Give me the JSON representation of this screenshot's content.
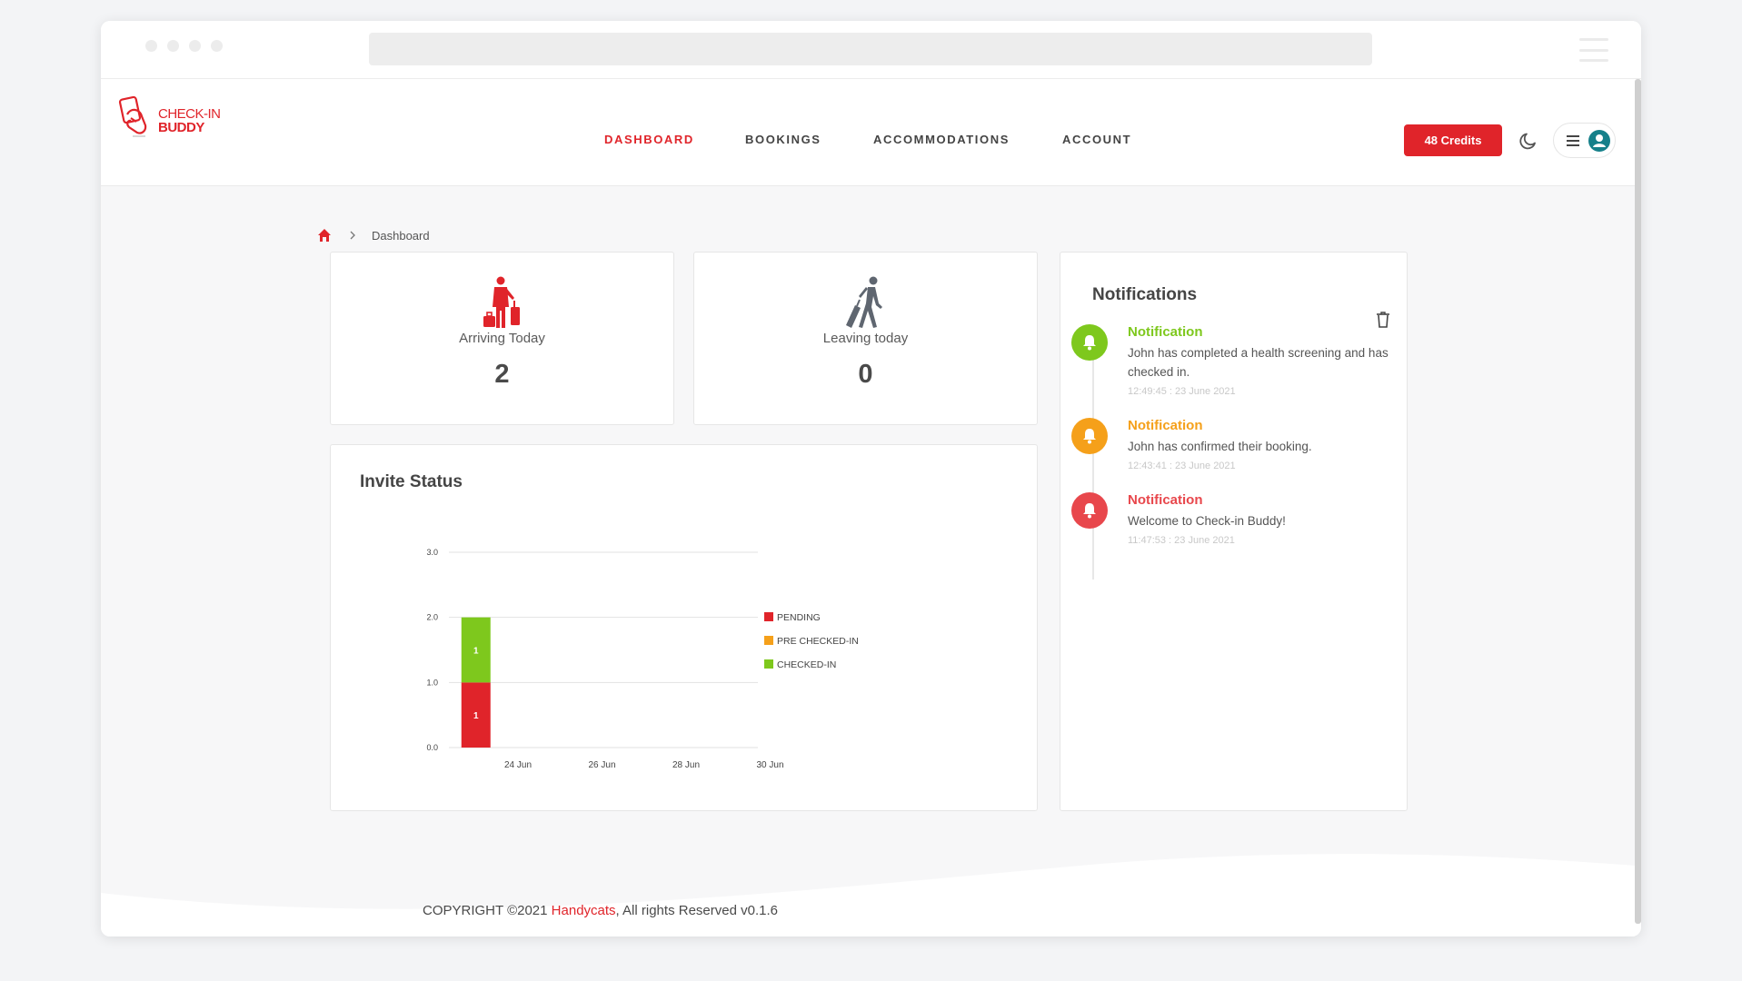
{
  "nav": {
    "links": [
      {
        "label": "DASHBOARD",
        "active": true
      },
      {
        "label": "BOOKINGS",
        "active": false
      },
      {
        "label": "ACCOMMODATIONS",
        "active": false
      },
      {
        "label": "ACCOUNT",
        "active": false
      }
    ],
    "credits_label": "48 Credits",
    "brand_line1": "CHECK-IN",
    "brand_line2": "BUDDY"
  },
  "breadcrumb": {
    "current": "Dashboard"
  },
  "stats": {
    "arriving": {
      "label": "Arriving Today",
      "value": "2"
    },
    "leaving": {
      "label": "Leaving today",
      "value": "0"
    }
  },
  "invite_status": {
    "title": "Invite Status"
  },
  "chart_data": {
    "type": "bar",
    "stacked": true,
    "title": "Invite Status",
    "x_ticks": [
      "24 Jun",
      "26 Jun",
      "28 Jun",
      "30 Jun"
    ],
    "y_ticks": [
      "0.0",
      "1.0",
      "2.0",
      "3.0"
    ],
    "ylim": [
      0,
      3
    ],
    "grid": true,
    "legend_position": "right",
    "bars": [
      {
        "date": "23 Jun",
        "segments": [
          {
            "series": "PENDING",
            "value": 1,
            "label": "1"
          },
          {
            "series": "CHECKED-IN",
            "value": 1,
            "label": "1"
          }
        ]
      }
    ],
    "series": [
      {
        "name": "PENDING",
        "color": "#e0242a"
      },
      {
        "name": "PRE CHECKED-IN",
        "color": "#f5a01a"
      },
      {
        "name": "CHECKED-IN",
        "color": "#7ec81d"
      }
    ]
  },
  "notifications": {
    "title": "Notifications",
    "items": [
      {
        "title": "Notification",
        "message": "John has completed a health screening and has checked in.",
        "time": "12:49:45 : 23 June 2021",
        "color": "#7ec81d"
      },
      {
        "title": "Notification",
        "message": "John has confirmed their booking.",
        "time": "12:43:41 : 23 June 2021",
        "color": "#f5a01a"
      },
      {
        "title": "Notification",
        "message": "Welcome to Check-in Buddy!",
        "time": "11:47:53 : 23 June 2021",
        "color": "#e8474c"
      }
    ]
  },
  "footer": {
    "prefix": "COPYRIGHT ©2021 ",
    "link": "Handycats",
    "suffix": ", All rights Reserved v0.1.6"
  },
  "colors": {
    "accent": "#e0242a",
    "avatar": "#16808a"
  }
}
